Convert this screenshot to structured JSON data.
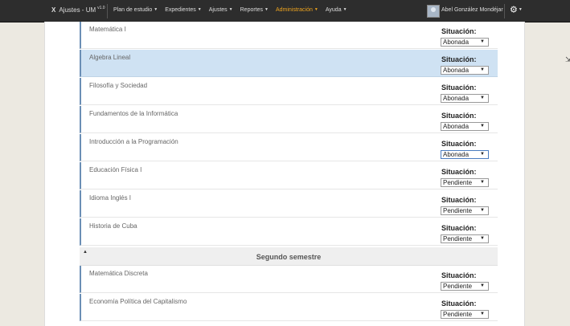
{
  "app": {
    "logo": "X",
    "name": "Ajustes - UM",
    "version": "v1.0"
  },
  "menu": [
    {
      "label": "Plan de estudio"
    },
    {
      "label": "Expedientes"
    },
    {
      "label": "Ajustes"
    },
    {
      "label": "Reportes"
    },
    {
      "label": "Administración",
      "active": true
    },
    {
      "label": "Ayuda"
    }
  ],
  "user": {
    "name": "Abel González Mondéjar"
  },
  "situation_label": "Situación:",
  "first_semester_subjects": [
    {
      "name": "Matemática I",
      "status": "Abonada"
    },
    {
      "name": "Algebra Lineal",
      "status": "Abonada"
    },
    {
      "name": "Filosofía y Sociedad",
      "status": "Abonada"
    },
    {
      "name": "Fundamentos de la Informática",
      "status": "Abonada"
    },
    {
      "name": "Introducción a la Programación",
      "status": "Abonada"
    },
    {
      "name": "Educación Física I",
      "status": "Pendiente"
    },
    {
      "name": "Idioma Inglés I",
      "status": "Pendiente"
    },
    {
      "name": "Historia de Cuba",
      "status": "Pendiente"
    }
  ],
  "second_semester": {
    "title": "Segundo semestre",
    "subjects": [
      {
        "name": "Matemática Discreta",
        "status": "Pendiente"
      },
      {
        "name": "Economía Política del Capitalismo",
        "status": "Pendiente"
      }
    ]
  },
  "colors": {
    "navbar": "#2d2d2d",
    "active_menu": "#f0a51e",
    "row_border": "#6b8fb5",
    "highlight": "#cfe2f3"
  }
}
